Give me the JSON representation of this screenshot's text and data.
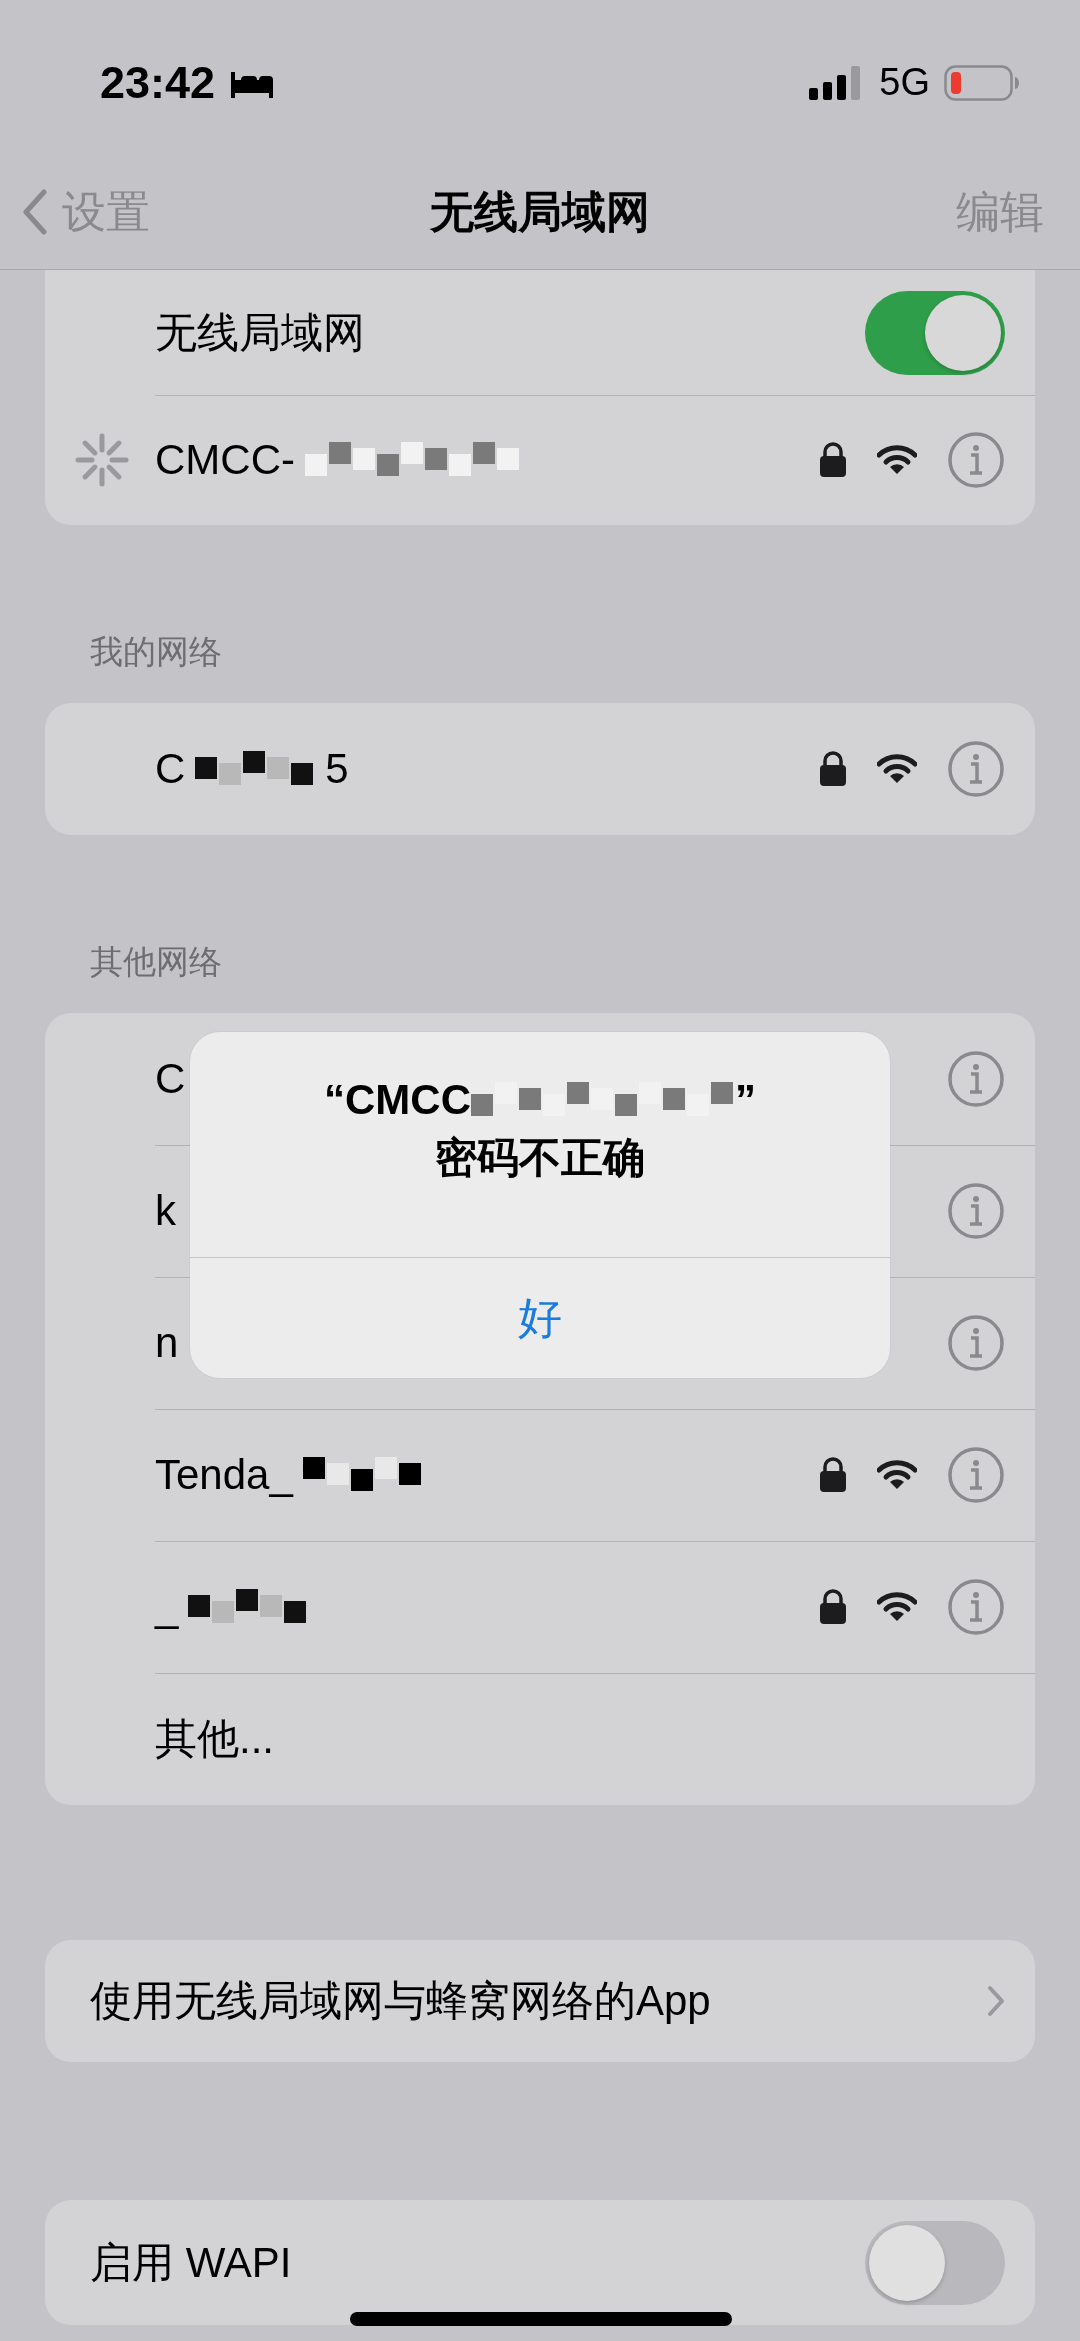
{
  "status_bar": {
    "time": "23:42",
    "network": "5G"
  },
  "nav": {
    "back": "设置",
    "title": "无线局域网",
    "action": "编辑"
  },
  "wifi_toggle": {
    "label": "无线局域网",
    "on": true
  },
  "current_network": {
    "name": "CMCC-",
    "redacted": true,
    "connecting": true,
    "locked": true
  },
  "my_networks": {
    "header": "我的网络",
    "items": [
      {
        "kind": "network",
        "name": "C",
        "suffix": "5",
        "redacted": true,
        "locked": true,
        "covered": false
      }
    ]
  },
  "other_networks": {
    "header": "其他网络",
    "items": [
      {
        "kind": "network",
        "name": "C",
        "covered": true
      },
      {
        "kind": "network",
        "name": "k",
        "covered": true
      },
      {
        "kind": "network",
        "name": "n",
        "covered": true
      },
      {
        "kind": "network",
        "name": "Tenda_",
        "redacted": true,
        "locked": true,
        "covered": false
      },
      {
        "kind": "network",
        "name": "_",
        "redacted": true,
        "locked": true,
        "covered": false
      },
      {
        "kind": "other",
        "name": "其他..."
      }
    ]
  },
  "apps_row": {
    "label": "使用无线局域网与蜂窝网络的App"
  },
  "wapi": {
    "label": "启用 WAPI",
    "on": false
  },
  "alert": {
    "title_prefix": "“CMCC",
    "title_suffix": "”",
    "redacted": true,
    "message": "密码不正确",
    "button": "好"
  }
}
